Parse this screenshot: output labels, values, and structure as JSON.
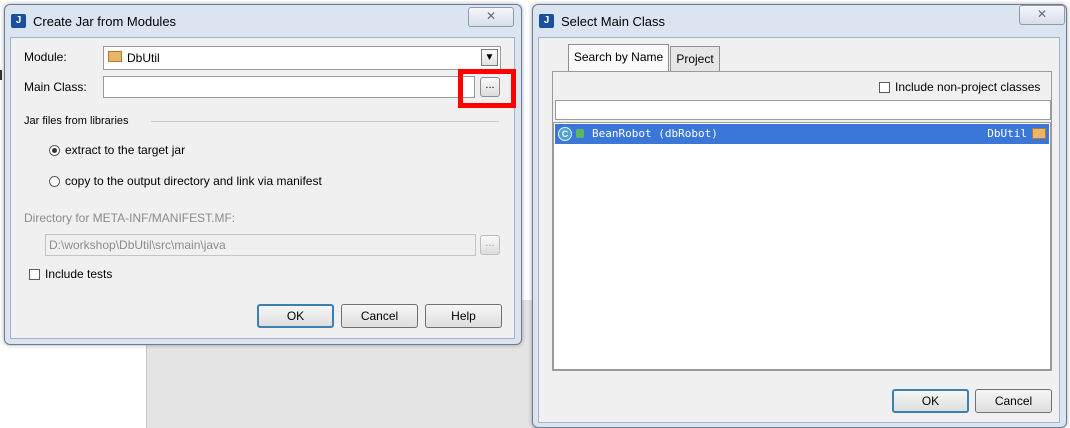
{
  "create_jar": {
    "title": "Create Jar from Modules",
    "close_glyph": "✕",
    "module_label": "Module:",
    "module_value": "DbUtil",
    "main_class_label": "Main Class:",
    "main_class_value": "",
    "browse_glyph": "...",
    "group_label": "Jar files from libraries",
    "radio_extract": "extract to the target jar",
    "radio_copy": "copy to the output directory and link via manifest",
    "dir_label": "Directory for META-INF/MANIFEST.MF:",
    "dir_value": "D:\\workshop\\DbUtil\\src\\main\\java",
    "include_tests": "Include tests",
    "ok": "OK",
    "cancel": "Cancel",
    "help": "Help"
  },
  "select_main": {
    "title": "Select Main Class",
    "close_glyph": "✕",
    "tabs": [
      {
        "label": "Search by Name",
        "active": true
      },
      {
        "label": "Project",
        "active": false
      }
    ],
    "include_non_project": "Include non-project classes",
    "search_value": "",
    "results": [
      {
        "name": "BeanRobot (dbRobot)",
        "module": "DbUtil",
        "selected": true
      }
    ],
    "ok": "OK",
    "cancel": "Cancel"
  },
  "colors": {
    "highlight": "#ff0000",
    "selection": "#3b77d8"
  }
}
